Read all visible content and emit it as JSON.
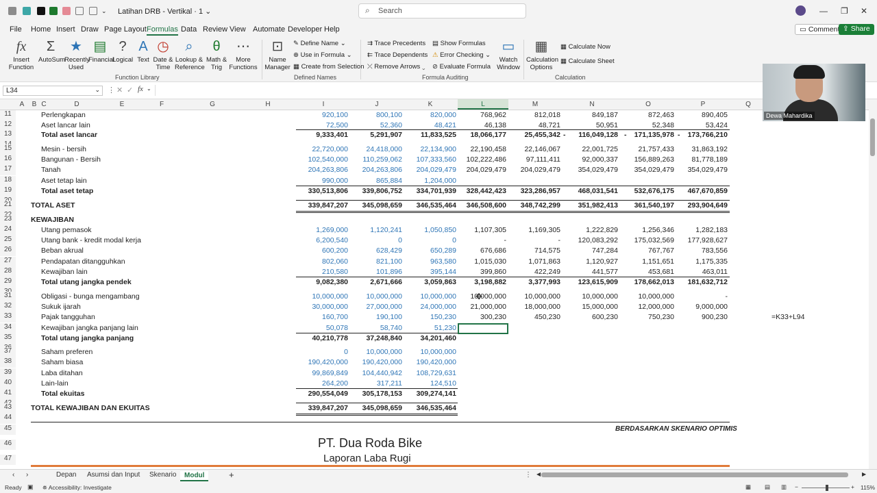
{
  "titlebar": {
    "doc_title": "Latihan DRB - Vertikal  ·  1 ⌄",
    "search_placeholder": "Search",
    "minimize": "—",
    "restore": "❐",
    "close": "✕"
  },
  "menu": {
    "items": [
      "File",
      "Home",
      "Insert",
      "Draw",
      "Page Layout",
      "Formulas",
      "Data",
      "Review",
      "View",
      "Automate",
      "Developer",
      "Help"
    ],
    "active": "Formulas",
    "comments": "Comments",
    "share": "Share"
  },
  "ribbon": {
    "insert_function": "Insert Function",
    "autosum": "AutoSum",
    "recently_used": "Recently Used",
    "financial": "Financial",
    "logical": "Logical",
    "text": "Text",
    "date_time": "Date & Time",
    "lookup_reference": "Lookup & Reference",
    "math_trig": "Math & Trig",
    "more_functions": "More Functions",
    "group_function_library": "Function Library",
    "name_manager": "Name Manager",
    "define_name": "Define Name",
    "use_in_formula": "Use in Formula",
    "create_from_selection": "Create from Selection",
    "group_defined_names": "Defined Names",
    "trace_precedents": "Trace Precedents",
    "trace_dependents": "Trace Dependents",
    "remove_arrows": "Remove Arrows",
    "show_formulas": "Show Formulas",
    "error_checking": "Error Checking",
    "evaluate_formula": "Evaluate Formula",
    "watch_window": "Watch Window",
    "group_formula_auditing": "Formula Auditing",
    "calculation_options": "Calculation Options",
    "calculate_now": "Calculate Now",
    "calculate_sheet": "Calculate Sheet",
    "group_calculation": "Calculation"
  },
  "formula_bar": {
    "name_box": "L34",
    "fx": "fx",
    "content": ""
  },
  "columns": [
    "A",
    "B",
    "C",
    "D",
    "E",
    "F",
    "G",
    "H",
    "I",
    "J",
    "K",
    "L",
    "M",
    "N",
    "O",
    "P",
    "Q"
  ],
  "rows": [
    {
      "n": "11",
      "label": "Perlengkapan",
      "i": "920,100",
      "j": "800,100",
      "k": "820,000",
      "l": "768,962",
      "m": "812,018",
      "nn": "849,187",
      "o": "872,463",
      "p": "890,405"
    },
    {
      "n": "12",
      "label": "Aset lancar lain",
      "i": "72,500",
      "j": "52,360",
      "k": "48,421",
      "l": "46,138",
      "m": "48,721",
      "nn": "50,951",
      "o": "52,348",
      "p": "53,424"
    },
    {
      "n": "13",
      "label": "Total aset lancar",
      "i": "9,333,401",
      "j": "5,291,907",
      "k": "11,833,525",
      "l": "18,066,177",
      "m": "25,455,342",
      "nn": "116,049,128",
      "o": "171,135,978",
      "p": "173,766,210",
      "dash_m": "-",
      "dash_n": "-",
      "dash_o": "-"
    },
    {
      "n": "15",
      "label": "Mesin - bersih",
      "i": "22,720,000",
      "j": "24,418,000",
      "k": "22,134,900",
      "l": "22,190,458",
      "m": "22,146,067",
      "nn": "22,001,725",
      "o": "21,757,433",
      "p": "31,863,192"
    },
    {
      "n": "16",
      "label": "Bangunan - Bersih",
      "i": "102,540,000",
      "j": "110,259,062",
      "k": "107,333,560",
      "l": "102,222,486",
      "m": "97,111,411",
      "nn": "92,000,337",
      "o": "156,889,263",
      "p": "81,778,189"
    },
    {
      "n": "17",
      "label": "Tanah",
      "i": "204,263,806",
      "j": "204,263,806",
      "k": "204,029,479",
      "l": "204,029,479",
      "m": "204,029,479",
      "nn": "354,029,479",
      "o": "354,029,479",
      "p": "354,029,479"
    },
    {
      "n": "18",
      "label": "Aset tetap lain",
      "i": "990,000",
      "j": "865,884",
      "k": "1,204,000",
      "l": "",
      "m": "",
      "nn": "",
      "o": "",
      "p": ""
    },
    {
      "n": "19",
      "label": "Total aset tetap",
      "i": "330,513,806",
      "j": "339,806,752",
      "k": "334,701,939",
      "l": "328,442,423",
      "m": "323,286,957",
      "nn": "468,031,541",
      "o": "532,676,175",
      "p": "467,670,859"
    },
    {
      "n": "21",
      "label": "TOTAL ASET",
      "i": "339,847,207",
      "j": "345,098,659",
      "k": "346,535,464",
      "l": "346,508,600",
      "m": "348,742,299",
      "nn": "351,982,413",
      "o": "361,540,197",
      "p": "293,904,649"
    },
    {
      "n": "23",
      "label": "KEWAJIBAN"
    },
    {
      "n": "24",
      "label": "Utang pemasok",
      "i": "1,269,000",
      "j": "1,120,241",
      "k": "1,050,850",
      "l": "1,107,305",
      "m": "1,169,305",
      "nn": "1,222,829",
      "o": "1,256,346",
      "p": "1,282,183"
    },
    {
      "n": "25",
      "label": "Utang bank - kredit modal kerja",
      "i": "6,200,540",
      "j": "0",
      "k": "0",
      "l": "-",
      "m": "-",
      "nn": "120,083,292",
      "o": "175,032,569",
      "p": "177,928,627"
    },
    {
      "n": "26",
      "label": "Beban akrual",
      "i": "600,200",
      "j": "628,429",
      "k": "650,289",
      "l": "676,686",
      "m": "714,575",
      "nn": "747,284",
      "o": "767,767",
      "p": "783,556"
    },
    {
      "n": "27",
      "label": "Pendapatan ditangguhkan",
      "i": "802,060",
      "j": "821,100",
      "k": "963,580",
      "l": "1,015,030",
      "m": "1,071,863",
      "nn": "1,120,927",
      "o": "1,151,651",
      "p": "1,175,335"
    },
    {
      "n": "28",
      "label": "Kewajiban lain",
      "i": "210,580",
      "j": "101,896",
      "k": "395,144",
      "l": "399,860",
      "m": "422,249",
      "nn": "441,577",
      "o": "453,681",
      "p": "463,011"
    },
    {
      "n": "29",
      "label": "Total utang jangka pendek",
      "i": "9,082,380",
      "j": "2,671,666",
      "k": "3,059,863",
      "l": "3,198,882",
      "m": "3,377,993",
      "nn": "123,615,909",
      "o": "178,662,013",
      "p": "181,632,712"
    },
    {
      "n": "31",
      "label": "Obligasi - bunga mengambang",
      "i": "10,000,000",
      "j": "10,000,000",
      "k": "10,000,000",
      "l": "10,000,000",
      "m": "10,000,000",
      "nn": "10,000,000",
      "o": "10,000,000",
      "p": "-"
    },
    {
      "n": "32",
      "label": "Sukuk ijarah",
      "i": "30,000,000",
      "j": "27,000,000",
      "k": "24,000,000",
      "l": "21,000,000",
      "m": "18,000,000",
      "nn": "15,000,000",
      "o": "12,000,000",
      "p": "9,000,000"
    },
    {
      "n": "33",
      "label": "Pajak tangguhan",
      "i": "160,700",
      "j": "190,100",
      "k": "150,230",
      "l": "300,230",
      "m": "450,230",
      "nn": "600,230",
      "o": "750,230",
      "p": "900,230",
      "q": "=K33+L94"
    },
    {
      "n": "34",
      "label": "Kewajiban jangka panjang lain",
      "i": "50,078",
      "j": "58,740",
      "k": "51,230"
    },
    {
      "n": "35",
      "label": "Total utang jangka panjang",
      "i": "40,210,778",
      "j": "37,248,840",
      "k": "34,201,460"
    },
    {
      "n": "37",
      "label": "Saham preferen",
      "i": "0",
      "j": "10,000,000",
      "k": "10,000,000"
    },
    {
      "n": "38",
      "label": "Saham biasa",
      "i": "190,420,000",
      "j": "190,420,000",
      "k": "190,420,000"
    },
    {
      "n": "39",
      "label": "Laba ditahan",
      "i": "99,869,849",
      "j": "104,440,942",
      "k": "108,729,631"
    },
    {
      "n": "40",
      "label": "Lain-lain",
      "i": "264,200",
      "j": "317,211",
      "k": "124,510"
    },
    {
      "n": "41",
      "label": "Total ekuitas",
      "i": "290,554,049",
      "j": "305,178,153",
      "k": "309,274,141"
    },
    {
      "n": "43",
      "label": "TOTAL KEWAJIBAN DAN EKUITAS",
      "i": "339,847,207",
      "j": "345,098,659",
      "k": "346,535,464"
    }
  ],
  "lower": {
    "r44": "44",
    "r45": "45",
    "r46": "46",
    "r47": "47",
    "scenario": "BERDASARKAN SKENARIO OPTIMIS",
    "company": "PT. Dua Roda Bike",
    "report": "Laporan Laba Rugi"
  },
  "sheets": {
    "tabs": [
      "Depan",
      "Asumsi dan Input",
      "Skenario",
      "Modul"
    ],
    "active": "Modul",
    "add": "+"
  },
  "status": {
    "ready": "Ready",
    "accessibility": "Accessibility: Investigate",
    "zoom": "115%"
  },
  "webcam": {
    "name": "Dewa Mahardika"
  },
  "colors": {
    "accent": "#217346",
    "input_blue": "#2e75b6",
    "share_green": "#1a7f37"
  }
}
